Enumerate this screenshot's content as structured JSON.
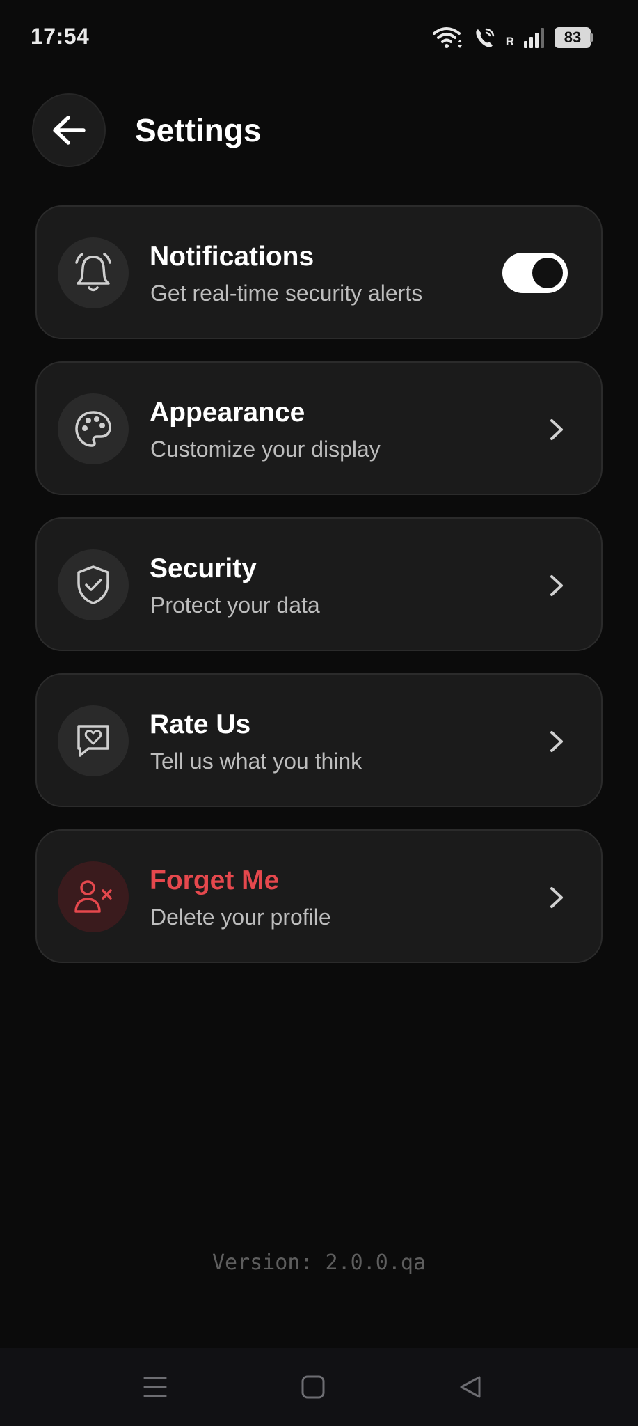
{
  "status_bar": {
    "time": "17:54",
    "carrier_indicator": "R",
    "battery": "83",
    "icons": [
      "wifi-icon",
      "wifi-calling-icon",
      "signal-icon",
      "battery-icon"
    ]
  },
  "header": {
    "title": "Settings",
    "back_icon": "arrow-left-icon"
  },
  "settings": [
    {
      "id": "notifications",
      "title": "Notifications",
      "subtitle": "Get real-time security alerts",
      "icon": "bell-icon",
      "control": "toggle",
      "enabled": true
    },
    {
      "id": "appearance",
      "title": "Appearance",
      "subtitle": "Customize your display",
      "icon": "palette-icon",
      "control": "chevron"
    },
    {
      "id": "security",
      "title": "Security",
      "subtitle": "Protect your data",
      "icon": "shield-check-icon",
      "control": "chevron"
    },
    {
      "id": "rate-us",
      "title": "Rate Us",
      "subtitle": "Tell us what you think",
      "icon": "message-heart-icon",
      "control": "chevron"
    },
    {
      "id": "forget-me",
      "title": "Forget Me",
      "subtitle": "Delete your profile",
      "icon": "user-x-icon",
      "control": "chevron",
      "danger": true
    }
  ],
  "footer": {
    "version": "Version: 2.0.0.qa"
  },
  "nav_bar": {
    "buttons": [
      "menu-icon",
      "home-icon",
      "back-triangle-icon"
    ]
  },
  "colors": {
    "background": "#0b0b0b",
    "card": "#1b1b1b",
    "danger": "#e5484d",
    "subtitle": "#bdbdbd"
  }
}
